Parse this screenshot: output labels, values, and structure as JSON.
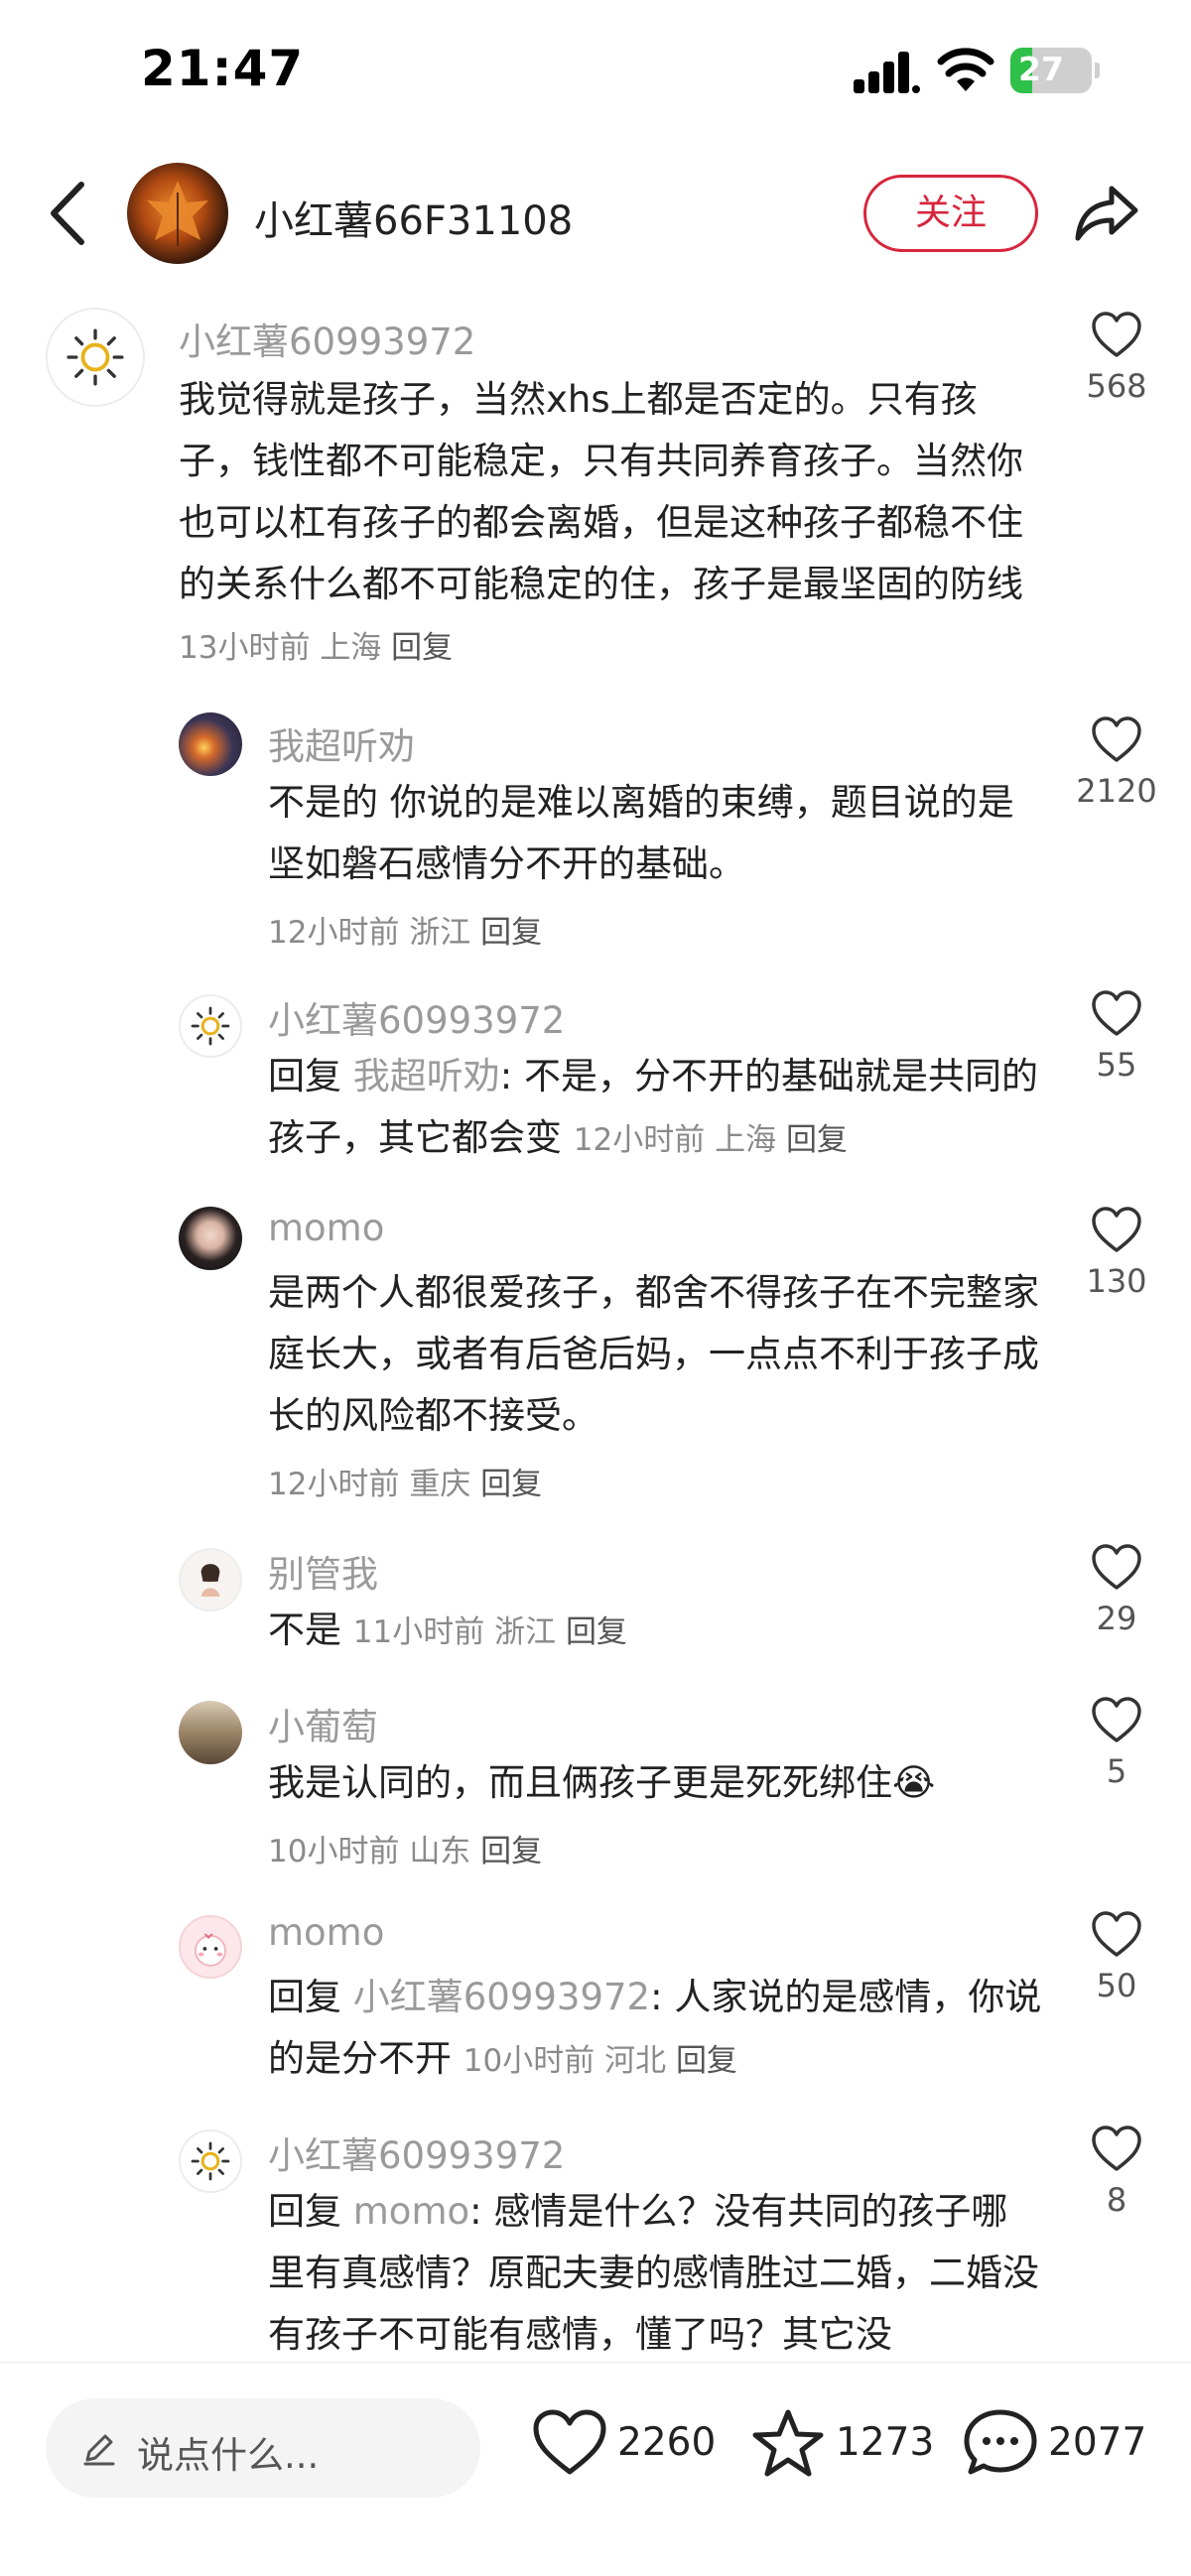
{
  "status": {
    "time": "21:47",
    "battery": "27",
    "battery_level": 0.27
  },
  "header": {
    "user_name": "小红薯66F31108",
    "follow_label": "关注"
  },
  "comments": [
    {
      "user": "小红薯60993972",
      "text": "我觉得就是孩子，当然xhs上都是否定的。只有孩子，钱性都不可能稳定，只有共同养育孩子。当然你也可以杠有孩子的都会离婚，但是这种孩子都稳不住的关系什么都不可能稳定的住，孩子是最坚固的防线",
      "time": "13小时前",
      "location": "上海",
      "reply": "回复",
      "likes": "568"
    },
    {
      "user": "我超听劝",
      "text": "不是的 你说的是难以离婚的束缚，题目说的是坚如磐石感情分不开的基础。",
      "time": "12小时前",
      "location": "浙江",
      "reply": "回复",
      "likes": "2120"
    },
    {
      "user": "小红薯60993972",
      "reply_prefix": "回复",
      "reply_to": "我超听劝",
      "text": ": 不是，分不开的基础就是共同的孩子，其它都会变",
      "time": "12小时前",
      "location": "上海",
      "reply": "回复",
      "likes": "55"
    },
    {
      "user": "momo",
      "text": "是两个人都很爱孩子，都舍不得孩子在不完整家庭长大，或者有后爸后妈，一点点不利于孩子成长的风险都不接受。",
      "time": "12小时前",
      "location": "重庆",
      "reply": "回复",
      "likes": "130"
    },
    {
      "user": "别管我",
      "text": "不是",
      "time": "11小时前",
      "location": "浙江",
      "reply": "回复",
      "likes": "29"
    },
    {
      "user": "小葡萄",
      "text": "我是认同的，而且俩孩子更是死死绑住",
      "emoji": "😭",
      "time": "10小时前",
      "location": "山东",
      "reply": "回复",
      "likes": "5"
    },
    {
      "user": "momo",
      "reply_prefix": "回复",
      "reply_to": "小红薯60993972",
      "text": ": 人家说的是感情，你说的是分不开",
      "time": "10小时前",
      "location": "河北",
      "reply": "回复",
      "likes": "50"
    },
    {
      "user": "小红薯60993972",
      "reply_prefix": "回复",
      "reply_to": "momo",
      "text": ": 感情是什么？没有共同的孩子哪里有真感情？原配夫妻的感情胜过二婚，二婚没有孩子不可能有感情，懂了吗？其它没",
      "likes": "8"
    }
  ],
  "bottom": {
    "placeholder": "说点什么...",
    "likes": "2260",
    "favorites": "1273",
    "comments": "2077"
  },
  "colors": {
    "accent": "#d7263d",
    "muted": "#9a9a9a",
    "battery": "#2fc04a"
  },
  "icons": [
    "back-icon",
    "share-icon",
    "heart-icon",
    "star-icon",
    "comment-icon",
    "pencil-icon",
    "signal-icon",
    "wifi-icon",
    "battery-icon",
    "sun-icon"
  ]
}
